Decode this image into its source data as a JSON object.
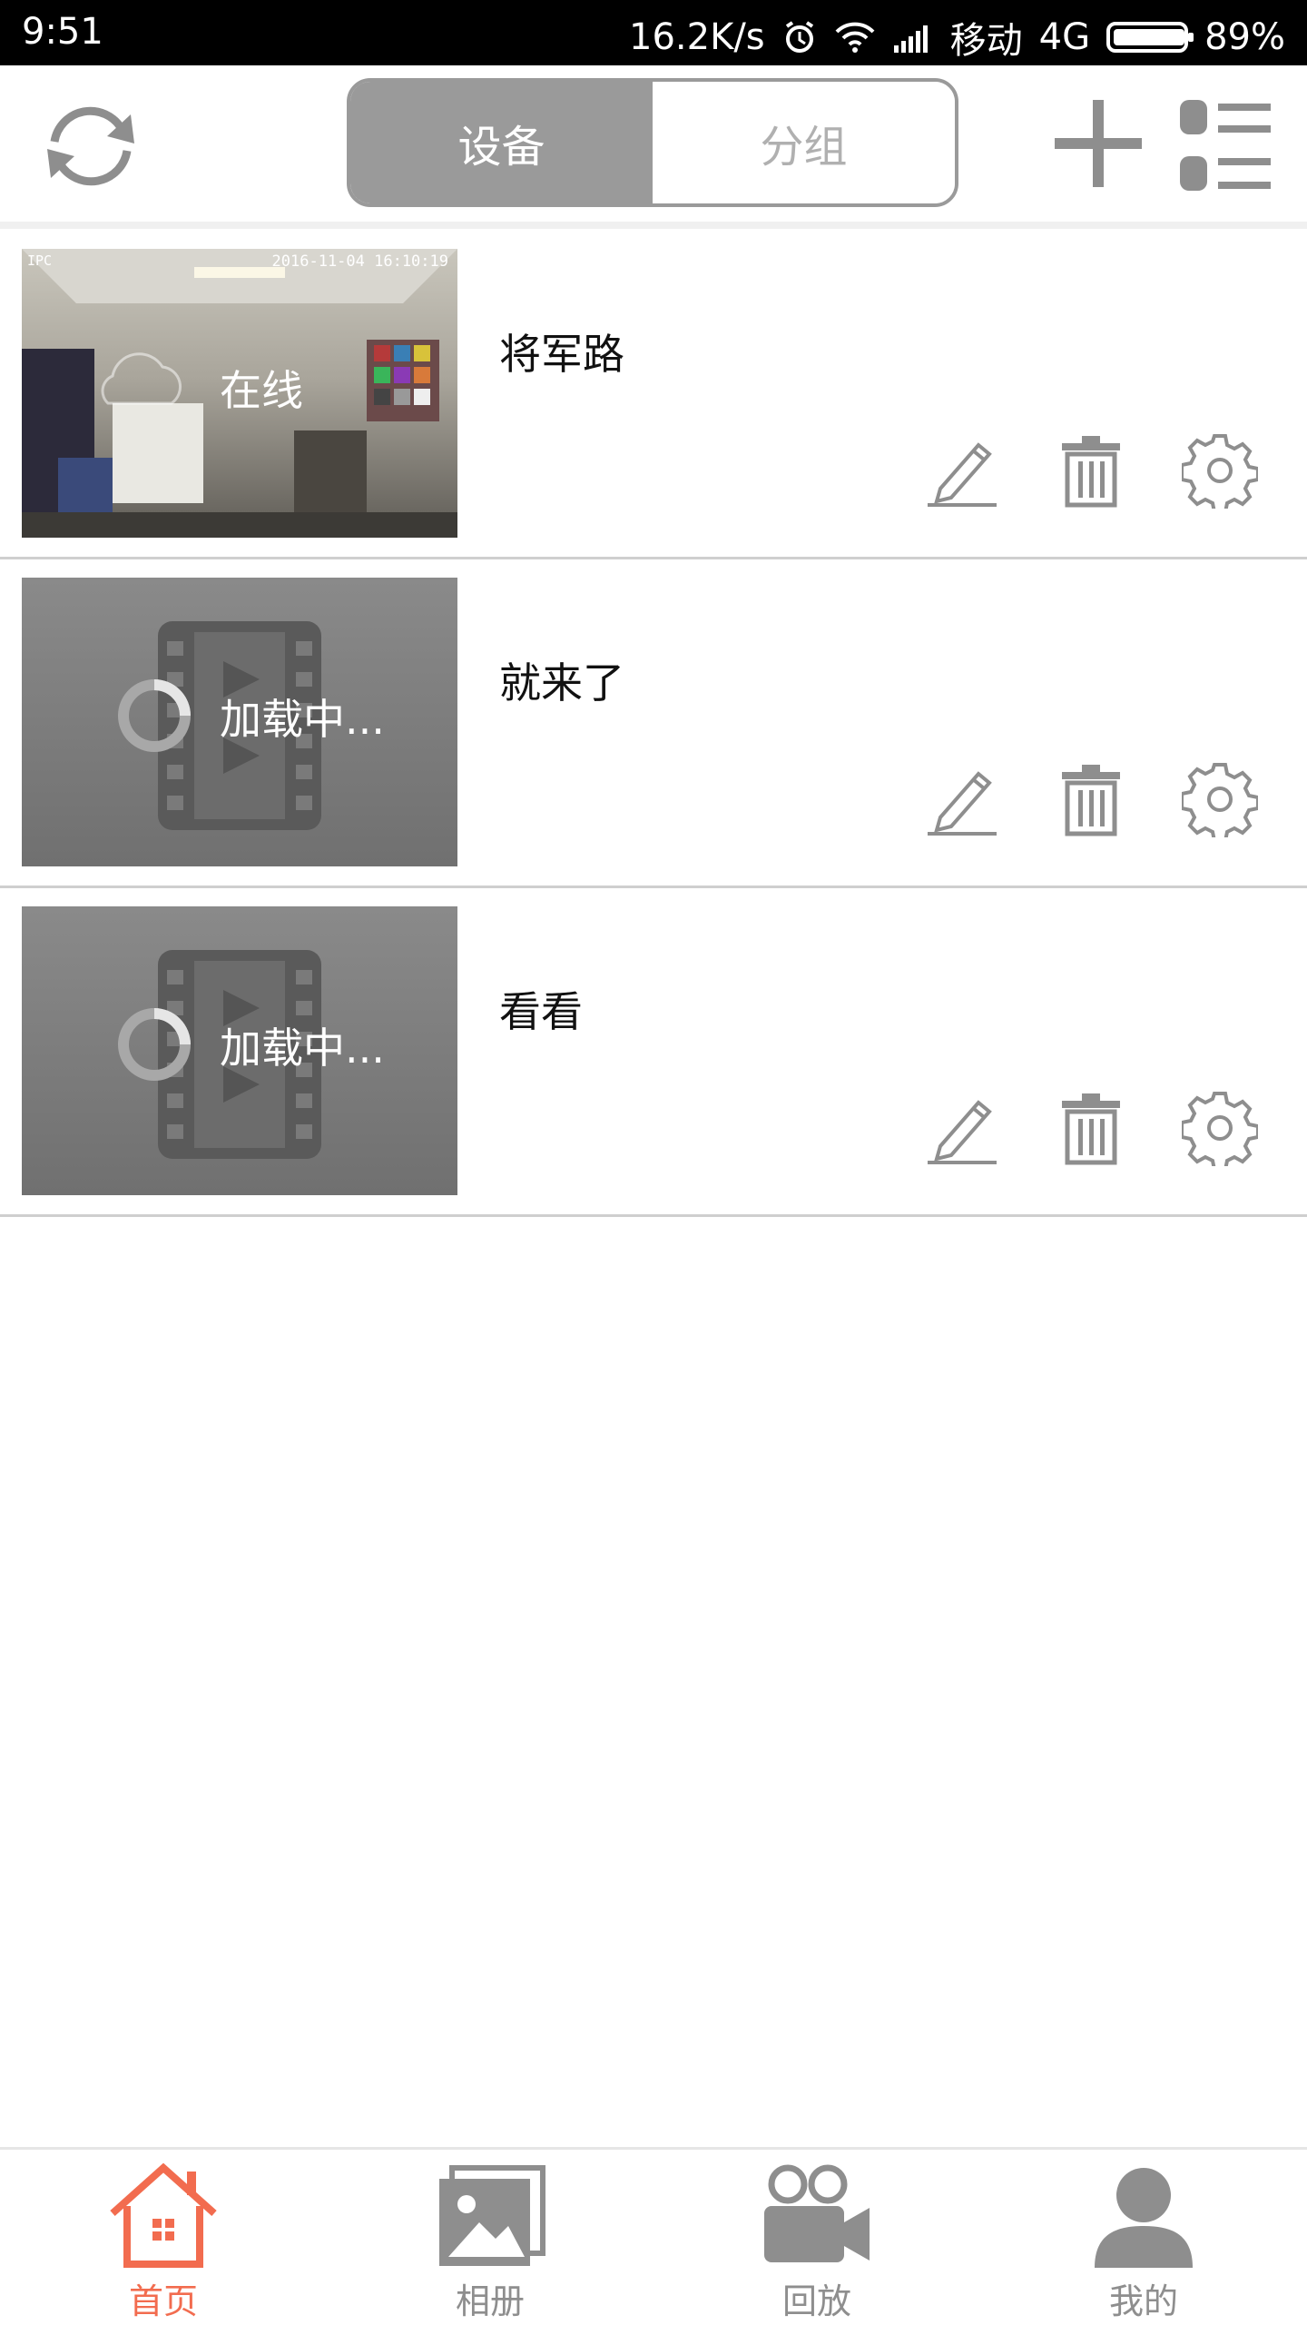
{
  "status_bar": {
    "time": "9:51",
    "net_speed": "16.2K/s",
    "carrier": "移动",
    "network": "4G",
    "battery": "89%"
  },
  "toolbar": {
    "segments": [
      "设备",
      "分组"
    ],
    "active_segment": "设备"
  },
  "devices": [
    {
      "name": "将军路",
      "status": "在线",
      "state": "online",
      "timestamp": "2016-11-04 16:10:19",
      "tag": "IPC"
    },
    {
      "name": "就来了",
      "status": "加载中...",
      "state": "loading"
    },
    {
      "name": "看看",
      "status": "加载中...",
      "state": "loading"
    }
  ],
  "bottom_nav": {
    "items": [
      {
        "label": "首页",
        "icon": "home-icon",
        "active": true
      },
      {
        "label": "相册",
        "icon": "album-icon",
        "active": false
      },
      {
        "label": "回放",
        "icon": "video-camera-icon",
        "active": false
      },
      {
        "label": "我的",
        "icon": "person-icon",
        "active": false
      }
    ]
  },
  "colors": {
    "accent": "#f26c4f",
    "icon_gray": "#8e8e8e",
    "segment_active": "#9a9a9a"
  }
}
